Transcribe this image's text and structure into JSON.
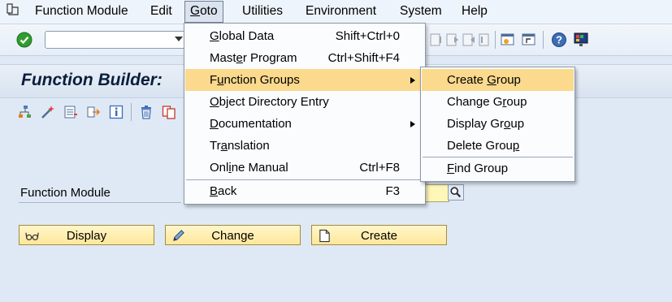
{
  "menubar": {
    "items": [
      {
        "label": "Function Module",
        "u": "",
        "rest": ""
      },
      {
        "label": "Edit",
        "u": "",
        "rest": ""
      },
      {
        "label": "Goto",
        "u": "G",
        "rest": "oto"
      },
      {
        "label": "Utilities",
        "u": "",
        "rest": ""
      },
      {
        "label": "Environment",
        "u": "",
        "rest": ""
      },
      {
        "label": "System",
        "u": "",
        "rest": ""
      },
      {
        "label": "Help",
        "u": "",
        "rest": ""
      }
    ]
  },
  "title": {
    "text": "Function Builder:"
  },
  "goto_menu": {
    "items": [
      {
        "pre": "",
        "u": "G",
        "post": "lobal Data",
        "shortcut": "Shift+Ctrl+0"
      },
      {
        "pre": "Mast",
        "u": "e",
        "post": "r Program",
        "shortcut": "Ctrl+Shift+F4"
      },
      {
        "pre": "F",
        "u": "u",
        "post": "nction Groups",
        "shortcut": ""
      },
      {
        "pre": "",
        "u": "O",
        "post": "bject Directory Entry",
        "shortcut": ""
      },
      {
        "pre": "",
        "u": "D",
        "post": "ocumentation",
        "shortcut": ""
      },
      {
        "pre": "Tr",
        "u": "a",
        "post": "nslation",
        "shortcut": ""
      },
      {
        "pre": "Onl",
        "u": "i",
        "post": "ne Manual",
        "shortcut": "Ctrl+F8"
      },
      {
        "pre": "",
        "u": "B",
        "post": "ack",
        "shortcut": "F3"
      }
    ]
  },
  "fg_menu": {
    "items": [
      {
        "pre": "Create ",
        "u": "G",
        "post": "roup"
      },
      {
        "pre": "Change G",
        "u": "r",
        "post": "oup"
      },
      {
        "pre": "Display Gr",
        "u": "o",
        "post": "up"
      },
      {
        "pre": "Delete Grou",
        "u": "p",
        "post": ""
      },
      {
        "pre": "",
        "u": "F",
        "post": "ind Group"
      }
    ]
  },
  "form": {
    "function_module_label": "Function Module"
  },
  "buttons": {
    "display": "Display",
    "change": "Change",
    "create": "Create"
  },
  "colors": {
    "menu_highlight": "#fbd98d",
    "button_fill": "#ffe79a",
    "input_fill": "#fff7b8"
  }
}
